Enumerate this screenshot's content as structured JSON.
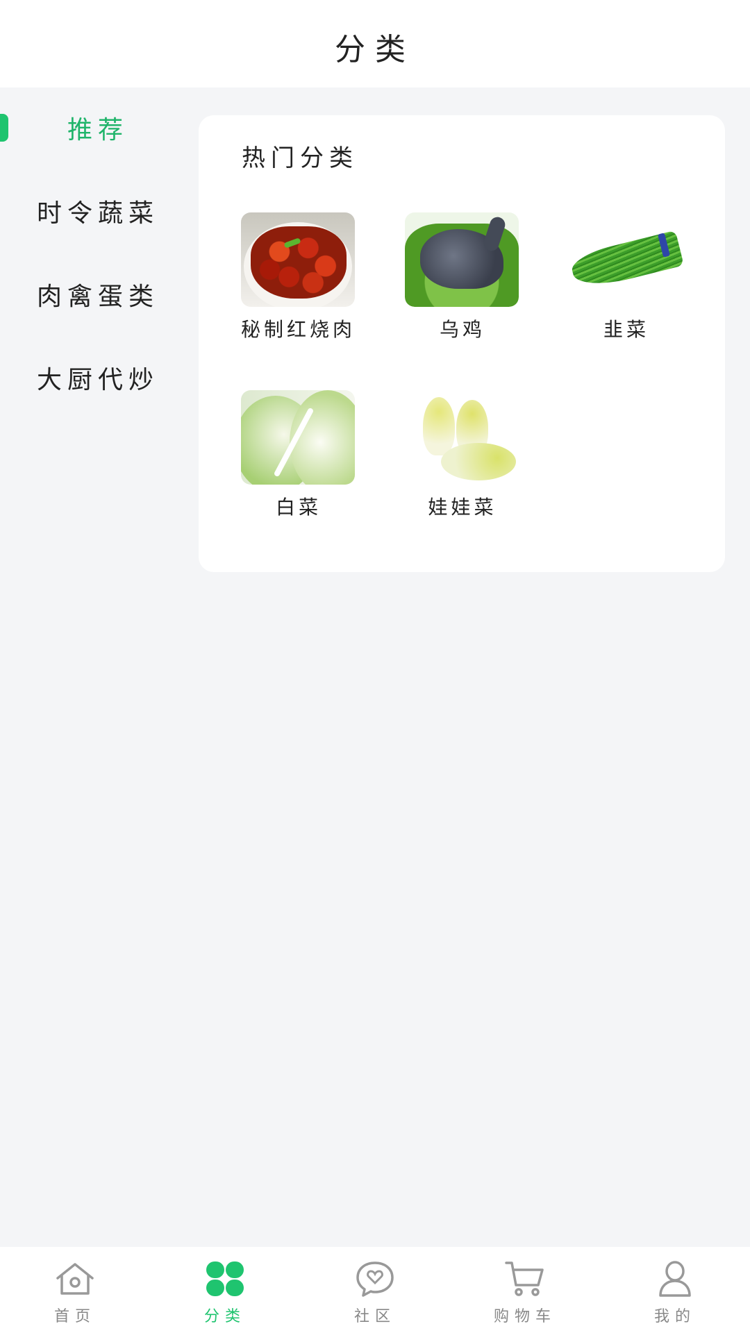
{
  "header": {
    "title": "分类"
  },
  "sidebar": {
    "items": [
      {
        "label": "推荐",
        "active": true
      },
      {
        "label": "时令蔬菜",
        "active": false
      },
      {
        "label": "肉禽蛋类",
        "active": false
      },
      {
        "label": "大厨代炒",
        "active": false
      }
    ],
    "accent_color": "#1fc46f"
  },
  "hot": {
    "title": "热门分类",
    "items": [
      {
        "label": "秘制红烧肉",
        "icon": "braised-pork-image"
      },
      {
        "label": "乌鸡",
        "icon": "black-chicken-image"
      },
      {
        "label": "韭菜",
        "icon": "chives-image"
      },
      {
        "label": "白菜",
        "icon": "napa-cabbage-image"
      },
      {
        "label": "娃娃菜",
        "icon": "baby-cabbage-image"
      }
    ]
  },
  "tabbar": {
    "active_color": "#1fc46f",
    "items": [
      {
        "label": "首页",
        "icon": "home-icon"
      },
      {
        "label": "分类",
        "icon": "category-icon",
        "active": true
      },
      {
        "label": "社区",
        "icon": "community-icon"
      },
      {
        "label": "购物车",
        "icon": "cart-icon"
      },
      {
        "label": "我的",
        "icon": "profile-icon"
      }
    ]
  }
}
